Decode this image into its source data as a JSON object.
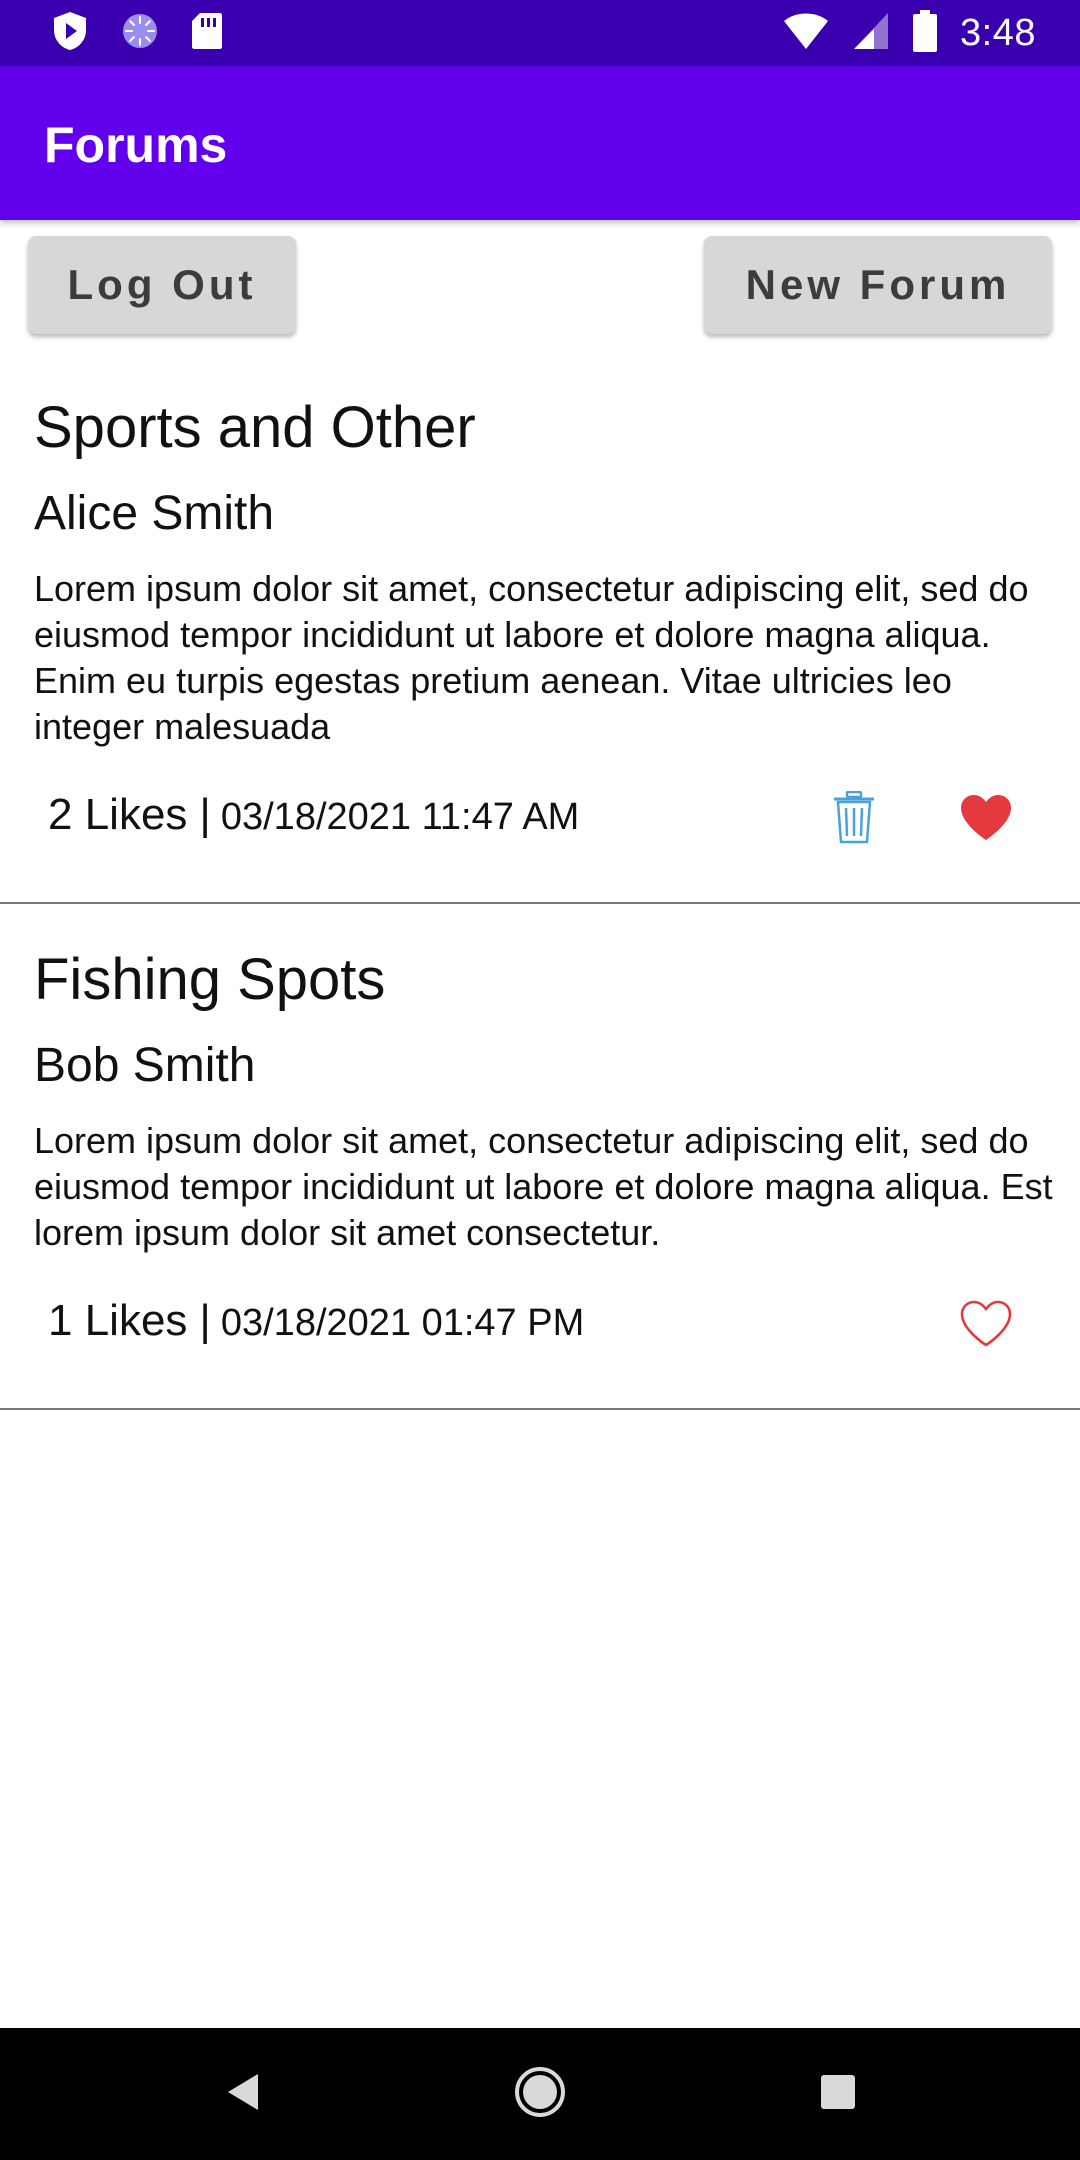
{
  "status_bar": {
    "time": "3:48",
    "icons": [
      "shield-play-icon",
      "spinner-icon",
      "sd-card-icon",
      "wifi-icon",
      "signal-icon",
      "battery-icon"
    ]
  },
  "toolbar": {
    "title": "Forums",
    "color": "#6200ee"
  },
  "actions": {
    "logout_label": "Log Out",
    "new_forum_label": "New Forum"
  },
  "forums": [
    {
      "title": "Sports and Other",
      "author": "Alice Smith",
      "body": "Lorem ipsum dolor sit amet, consectetur adipiscing elit, sed do eiusmod tempor incididunt ut labore et dolore magna aliqua. Enim eu turpis egestas pretium aenean. Vitae ultricies leo integer malesuada",
      "likes": "2 Likes",
      "separator": "|",
      "date": "03/18/2021 11:47 AM",
      "liked": true,
      "deletable": true
    },
    {
      "title": "Fishing Spots",
      "author": "Bob Smith",
      "body": "Lorem ipsum dolor sit amet, consectetur adipiscing elit, sed do eiusmod tempor incididunt ut labore et dolore magna aliqua. Est lorem ipsum dolor sit amet consectetur.",
      "likes": "1 Likes",
      "separator": "|",
      "date": "03/18/2021 01:47 PM",
      "liked": false,
      "deletable": false
    }
  ],
  "colors": {
    "status_bar": "#3a00b0",
    "heart": "#e53940",
    "trash": "#4aa3d8",
    "button_bg": "#d6d7d7"
  },
  "nav_bar": {
    "icons": [
      "back-icon",
      "home-icon",
      "recents-icon"
    ]
  }
}
